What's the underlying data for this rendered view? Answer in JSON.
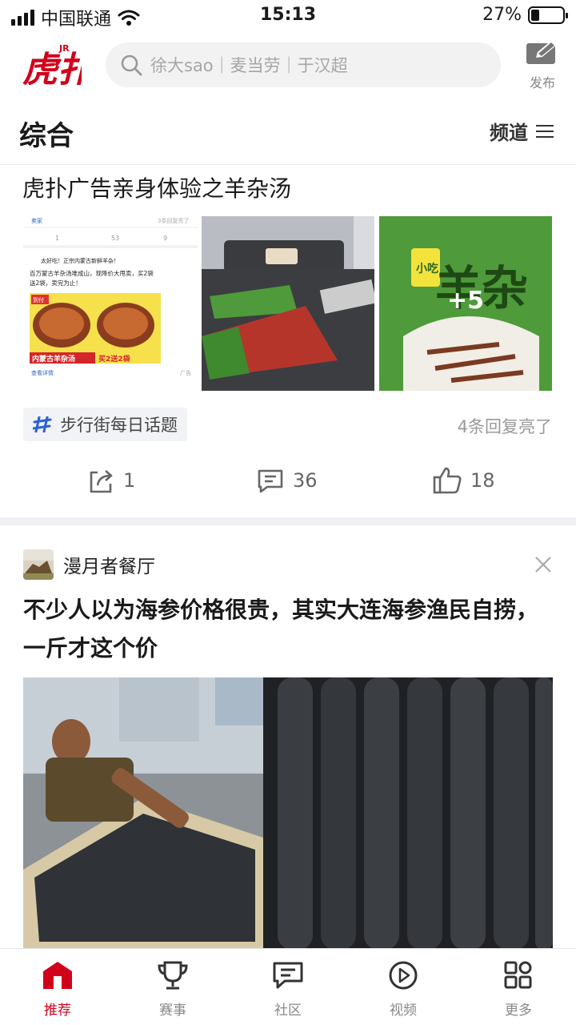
{
  "status_bar": {
    "carrier": "中国联通",
    "time": "15:13",
    "battery_percent": "27%",
    "battery_level": 0.27,
    "signal_icon": "signal-icon",
    "wifi_icon": "wifi-icon"
  },
  "header": {
    "logo_text": "虎扑",
    "logo_badge": "JR",
    "search_placeholder": "徐大sao｜麦当劳｜于汉超",
    "publish_label": "发布"
  },
  "section": {
    "title": "综合",
    "channel_label": "频道"
  },
  "post1": {
    "title": "虎扑广告亲身体验之羊杂汤",
    "more_images": "+5",
    "topic": "步行街每日话题",
    "replies_highlight": "4条回复亮了",
    "share_count": "1",
    "comment_count": "36",
    "like_count": "18",
    "thumb1": {
      "source": "卖家",
      "lit": "3条回复亮了",
      "counts": [
        "1",
        "53",
        "9"
      ],
      "ad_line": "太好吃！正宗内蒙古新鲜羊杂！",
      "ad_body": "百万蒙古羊杂汤堆成山，现降价大甩卖，买2袋送2袋，卖完为止！",
      "tag": "到付",
      "banner_left": "内蒙古羊杂汤",
      "banner_right": "买2送2袋",
      "link": "查看详情",
      "ad_mark": "广告"
    },
    "thumb3": {
      "pack_text": "羊杂",
      "side_text": "小吃"
    }
  },
  "post2": {
    "author": "漫月者餐厅",
    "title": "不少人以为海参价格很贵，其实大连海参渔民自捞，一斤才这个价"
  },
  "tabbar": [
    {
      "label": "推荐",
      "icon": "home-icon",
      "active": true
    },
    {
      "label": "赛事",
      "icon": "trophy-icon",
      "active": false
    },
    {
      "label": "社区",
      "icon": "chat-icon",
      "active": false
    },
    {
      "label": "视频",
      "icon": "play-icon",
      "active": false
    },
    {
      "label": "更多",
      "icon": "grid-icon",
      "active": false
    }
  ],
  "colors": {
    "brand_red": "#d0021b",
    "topic_blue": "#2a62d6"
  }
}
